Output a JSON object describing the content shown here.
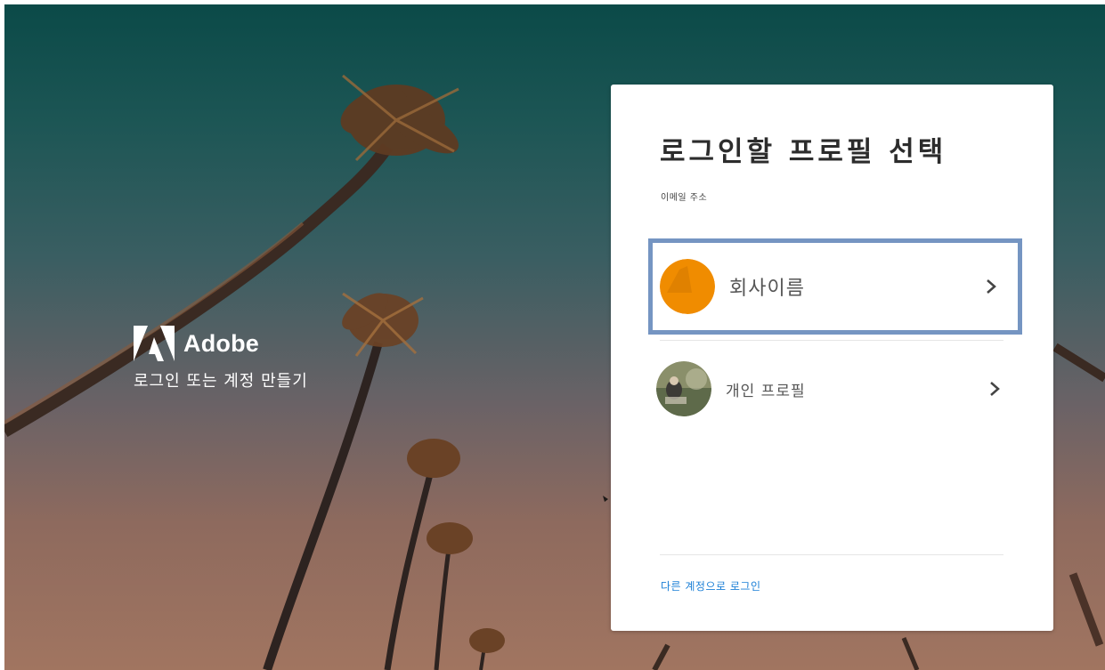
{
  "brand": {
    "name": "Adobe",
    "tagline": "로그인 또는 계정 만들기",
    "logo_icon": "adobe-logo-icon"
  },
  "card": {
    "title": "로그인할 프로필 선택",
    "email_label": "이메일 주소",
    "profiles": [
      {
        "label": "회사이름",
        "avatar_icon": "company-avatar-icon",
        "selected": true,
        "chevron_icon": "chevron-right-icon"
      },
      {
        "label": "개인 프로필",
        "avatar_icon": "personal-photo-avatar",
        "selected": false,
        "chevron_icon": "chevron-right-icon"
      }
    ],
    "other_account_link": "다른 계정으로 로그인"
  },
  "colors": {
    "highlight_border": "#7595c2",
    "company_avatar": "#f08c00",
    "link": "#1b7fd6"
  }
}
